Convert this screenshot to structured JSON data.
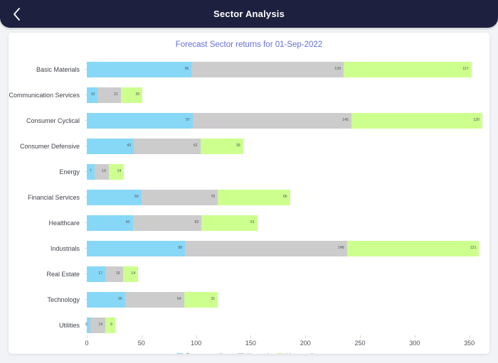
{
  "header": {
    "title": "Sector Analysis",
    "back_icon": "chevron-left-icon",
    "background_color": "#1e2040"
  },
  "card": {
    "chart_title": "Forecast Sector returns for 01-Sep-2022",
    "title_color": "#6470d6"
  },
  "colors": {
    "down_trending": "#87d8f7",
    "neutral": "#cccccc",
    "up_trending": "#cdff8e",
    "page_background": "#f2f3f6",
    "card_background": "#ffffff"
  },
  "legend": [
    {
      "label": "Down-trending",
      "color": "#87d8f7",
      "icon": "legend-swatch-down"
    },
    {
      "label": "Neutral",
      "color": "#cccccc",
      "icon": "legend-swatch-neutral"
    },
    {
      "label": "Up-trending",
      "color": "#cdff8e",
      "icon": "legend-swatch-up"
    }
  ],
  "chart_data": {
    "type": "bar",
    "orientation": "horizontal",
    "stacked": true,
    "title": "Forecast Sector returns for 01-Sep-2022",
    "xlabel": "",
    "ylabel": "",
    "xlim": [
      0,
      360
    ],
    "xticks": [
      0,
      50,
      100,
      150,
      200,
      250,
      300,
      350
    ],
    "xtick_labels": [
      "0",
      "50",
      "100",
      "150",
      "200",
      "250",
      "300",
      "350"
    ],
    "grid": false,
    "legend_position": "bottom-center",
    "categories": [
      "Basic Materials",
      "Communication Services",
      "Consumer Cyclical",
      "Consumer Defensive",
      "Energy",
      "Financial Services",
      "Healthcare",
      "Industrials",
      "Real Estate",
      "Technology",
      "Utilities"
    ],
    "series": [
      {
        "name": "Down-trending",
        "color": "#87d8f7",
        "values": [
          96,
          10,
          97,
          43,
          7,
          50,
          42,
          90,
          17,
          35,
          3
        ]
      },
      {
        "name": "Neutral",
        "color": "#cccccc",
        "values": [
          139,
          21,
          145,
          61,
          13,
          70,
          63,
          148,
          16,
          54,
          14
        ]
      },
      {
        "name": "Up-trending",
        "color": "#cdff8e",
        "values": [
          117,
          20,
          120,
          39,
          14,
          66,
          51,
          121,
          14,
          31,
          9
        ]
      }
    ]
  }
}
